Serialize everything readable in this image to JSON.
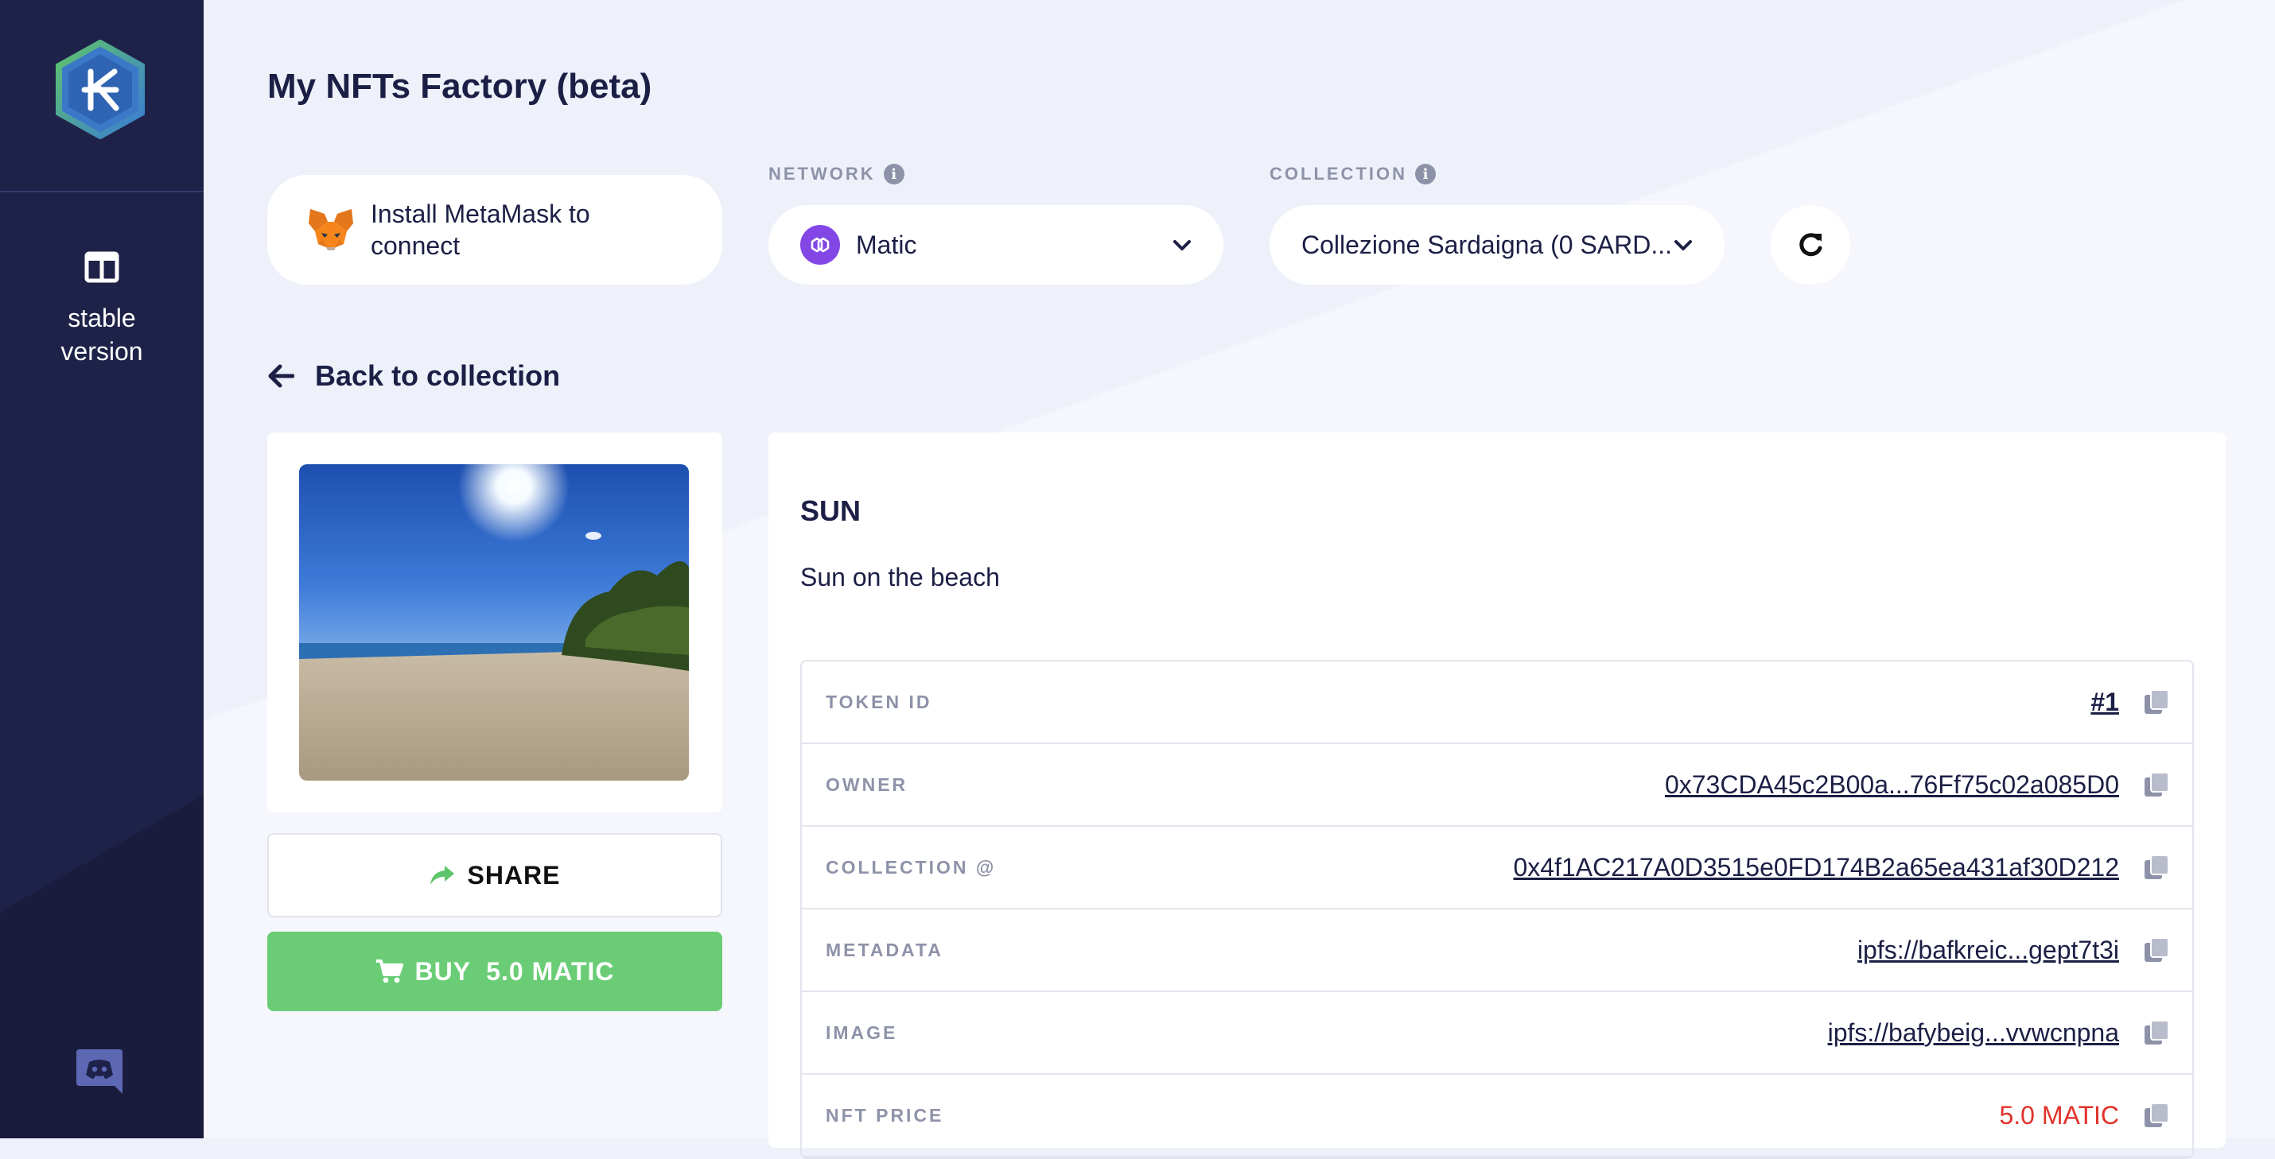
{
  "sidebar": {
    "stable_label": "stable\nversion"
  },
  "page": {
    "title": "My NFTs Factory (beta)"
  },
  "metamask": {
    "label": "Install MetaMask to connect"
  },
  "network": {
    "label": "NETWORK",
    "selected": "Matic"
  },
  "collection": {
    "label": "COLLECTION",
    "selected": "Collezione Sardaigna (0 SARD..."
  },
  "back": {
    "label": "Back to collection"
  },
  "nft": {
    "name": "SUN",
    "description": "Sun on the beach"
  },
  "actions": {
    "share_label": "SHARE",
    "buy_label": "BUY  5.0 MATIC"
  },
  "properties": [
    {
      "label": "TOKEN ID",
      "value": "#1"
    },
    {
      "label": "OWNER",
      "value": "0x73CDA45c2B00a...76Ff75c02a085D0"
    },
    {
      "label": "COLLECTION @",
      "value": "0x4f1AC217A0D3515e0FD174B2a65ea431af30D212"
    },
    {
      "label": "METADATA",
      "value": "ipfs://bafkreic...gept7t3i"
    },
    {
      "label": "IMAGE",
      "value": "ipfs://bafybeig...vvwcnpna"
    },
    {
      "label": "NFT PRICE",
      "value": "5.0 MATIC"
    }
  ],
  "colors": {
    "sidebar": "#1f2248",
    "buy": "#6acd76",
    "price": "#e0322a",
    "matic": "#8247e5"
  }
}
